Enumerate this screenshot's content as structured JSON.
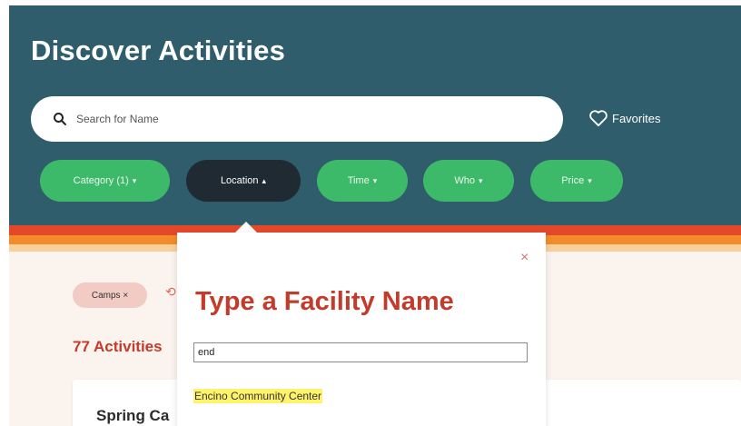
{
  "header": {
    "title": "Discover Activities",
    "search": {
      "placeholder": "Search for Name",
      "value": ""
    },
    "favorites_label": "Favorites",
    "filters": [
      {
        "label": "Category (1)",
        "chevron": "▾",
        "active": false
      },
      {
        "label": "Location",
        "chevron": "▴",
        "active": true
      },
      {
        "label": "Time",
        "chevron": "▾",
        "active": false
      },
      {
        "label": "Who",
        "chevron": "▾",
        "active": false
      },
      {
        "label": "Price",
        "chevron": "▾",
        "active": false
      }
    ]
  },
  "results": {
    "tags": [
      {
        "label": "Camps",
        "remove": "×"
      }
    ],
    "count_label": "77 Activities",
    "cards": [
      {
        "title": "Spring Ca"
      }
    ]
  },
  "location_popover": {
    "close_glyph": "×",
    "heading": "Type a Facility Name",
    "input_value": "end",
    "suggestions": [
      "Encino Community Center"
    ]
  },
  "colors": {
    "header_bg": "#2f5d6b",
    "chip_green": "#3dba69",
    "chip_active": "#1f2a33",
    "accent_red": "#c23b2b",
    "highlight": "#fff36b"
  },
  "icons": {
    "search": "search-icon",
    "favorites": "heart-icon",
    "close": "close-icon"
  }
}
